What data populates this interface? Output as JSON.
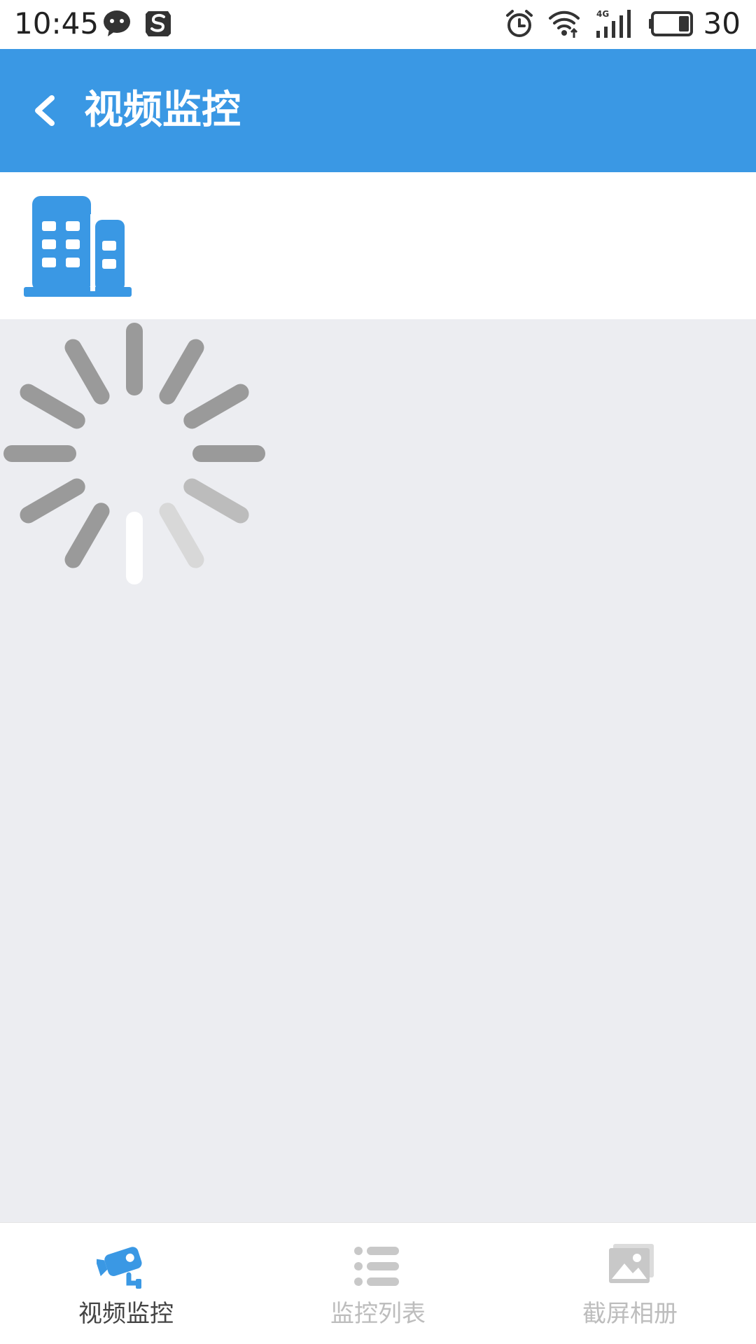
{
  "status_bar": {
    "time": "10:45",
    "battery_text": "30",
    "icons": [
      "wechat-icon",
      "sogou-icon",
      "alarm-icon",
      "wifi-icon",
      "signal-4g-icon",
      "battery-icon"
    ]
  },
  "app_bar": {
    "title": "视频监控",
    "back_icon": "chevron-left-icon",
    "background": "#3a98e4"
  },
  "org": {
    "icon": "building-icon",
    "icon_color": "#3a98e4"
  },
  "content": {
    "state": "loading",
    "spinner_icon": "loading-spinner-icon",
    "background": "#ecedf1"
  },
  "bottom_nav": {
    "items": [
      {
        "label": "视频监控",
        "icon": "camera-icon",
        "active": true
      },
      {
        "label": "监控列表",
        "icon": "list-icon",
        "active": false
      },
      {
        "label": "截屏相册",
        "icon": "photo-album-icon",
        "active": false
      }
    ],
    "active_color": "#3a98e4",
    "inactive_color": "#c8c8c8"
  }
}
